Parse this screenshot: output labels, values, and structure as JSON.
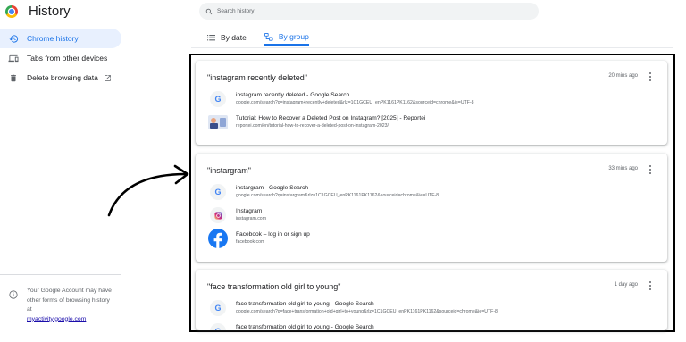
{
  "app": {
    "title": "History"
  },
  "sidebar": {
    "items": [
      {
        "label": "Chrome history",
        "icon": "history-icon",
        "active": true
      },
      {
        "label": "Tabs from other devices",
        "icon": "devices-icon",
        "active": false
      },
      {
        "label": "Delete browsing data",
        "icon": "trash-icon",
        "active": false
      }
    ],
    "account_note": {
      "text": "Your Google Account may have other forms of browsing history at",
      "link": "myactivity.google.com"
    }
  },
  "search": {
    "placeholder": "Search history"
  },
  "tabs": [
    {
      "label": "By date",
      "active": false
    },
    {
      "label": "By group",
      "active": true
    }
  ],
  "groups": [
    {
      "title": "\"instagram recently deleted\"",
      "time": "20 mins ago",
      "entries": [
        {
          "title": "instagram recently deleted - Google Search",
          "url": "google.com/search?q=instagram+recently+deleted&rlz=1C1GCEU_enPK1161PK1162&sourceid=chrome&ie=UTF-8",
          "favicon": "google-icon"
        },
        {
          "title": "Tutorial: How to Recover a Deleted Post on Instagram? [2025] - Reportei",
          "url": "reportei.com/en/tutorial-how-to-recover-a-deleted-post-on-instagram-2023/",
          "favicon": "reportei-thumbnail"
        }
      ]
    },
    {
      "title": "\"instargram\"",
      "time": "33 mins ago",
      "entries": [
        {
          "title": "instargram - Google Search",
          "url": "google.com/search?q=instargram&rlz=1C1GCEU_enPK1161PK1162&sourceid=chrome&ie=UTF-8",
          "favicon": "google-icon"
        },
        {
          "title": "Instagram",
          "url": "instagram.com",
          "favicon": "instagram-icon"
        },
        {
          "title": "Facebook – log in or sign up",
          "url": "facebook.com",
          "favicon": "facebook-icon"
        }
      ]
    },
    {
      "title": "\"face transformation old girl to young\"",
      "time": "1 day ago",
      "entries": [
        {
          "title": "face transformation old girl to young - Google Search",
          "url": "google.com/search?q=face+transformation+old+girl+to+young&rlz=1C1GCEU_enPK1161PK1162&sourceid=chrome&ie=UTF-8",
          "favicon": "google-icon"
        },
        {
          "title": "face transformation old girl to young - Google Search",
          "url": "",
          "favicon": "google-icon"
        }
      ]
    }
  ],
  "colors": {
    "accent": "#1a73e8",
    "active_bg": "#e8f0fe",
    "frame": "#000000"
  }
}
